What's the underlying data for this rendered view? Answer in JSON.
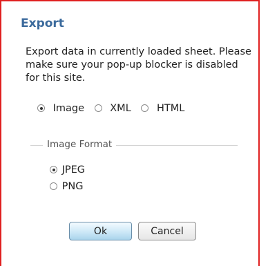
{
  "dialog": {
    "title": "Export",
    "description": "Export data in currently loaded sheet. Please make sure your pop-up blocker is disabled for this site.",
    "type_options": [
      {
        "label": "Image",
        "checked": true
      },
      {
        "label": "XML",
        "checked": false
      },
      {
        "label": "HTML",
        "checked": false
      }
    ],
    "image_format": {
      "legend": "Image Format",
      "options": [
        {
          "label": "JPEG",
          "checked": true
        },
        {
          "label": "PNG",
          "checked": false
        }
      ]
    },
    "buttons": {
      "ok": "Ok",
      "cancel": "Cancel"
    }
  },
  "colors": {
    "border": "#e02020",
    "title": "#3b6a9c"
  }
}
